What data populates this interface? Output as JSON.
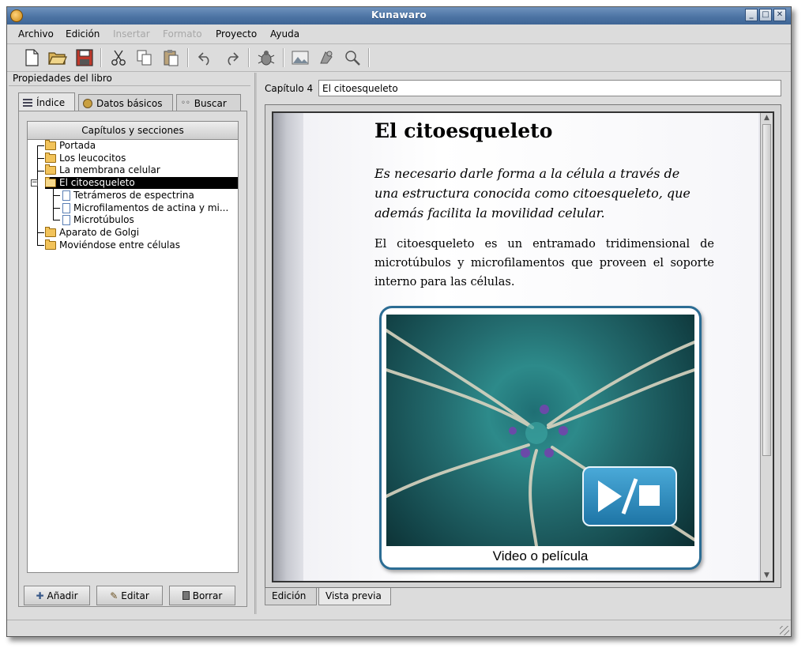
{
  "window": {
    "title": "Kunawaro"
  },
  "menu": [
    {
      "label": "Archivo",
      "enabled": true
    },
    {
      "label": "Edición",
      "enabled": true
    },
    {
      "label": "Insertar",
      "enabled": false
    },
    {
      "label": "Formato",
      "enabled": false
    },
    {
      "label": "Proyecto",
      "enabled": true
    },
    {
      "label": "Ayuda",
      "enabled": true
    }
  ],
  "toolbar": [
    "new-file-icon",
    "open-folder-icon",
    "save-icon",
    "cut-icon",
    "copy-icon",
    "paste-icon",
    "undo-icon",
    "redo-icon",
    "insert-bug-icon",
    "insert-image-icon",
    "insert-object-icon",
    "search-media-icon"
  ],
  "left_panel": {
    "header": "Propiedades del libro",
    "tabs": [
      {
        "label": "Índice",
        "icon": "list-icon",
        "active": true
      },
      {
        "label": "Datos básicos",
        "icon": "info-icon",
        "active": false
      },
      {
        "label": "Buscar",
        "icon": "glasses-icon",
        "active": false
      }
    ],
    "tree_header": "Capítulos y secciones",
    "tree": [
      {
        "label": "Portada",
        "type": "folder",
        "level": 0
      },
      {
        "label": "Los leucocitos",
        "type": "folder",
        "level": 0
      },
      {
        "label": "La membrana celular",
        "type": "folder",
        "level": 0
      },
      {
        "label": "El citoesqueleto",
        "type": "folder-open",
        "level": 0,
        "selected": true
      },
      {
        "label": "Tetrámeros de espectrina",
        "type": "page",
        "level": 1
      },
      {
        "label": "Microfilamentos de actina y mi...",
        "type": "page",
        "level": 1
      },
      {
        "label": "Microtúbulos",
        "type": "page",
        "level": 1
      },
      {
        "label": "Aparato de Golgi",
        "type": "folder",
        "level": 0
      },
      {
        "label": "Moviéndose entre células",
        "type": "folder",
        "level": 0
      }
    ],
    "buttons": {
      "add": "Añadir",
      "edit": "Editar",
      "delete": "Borrar"
    }
  },
  "chapter": {
    "label": "Capítulo 4",
    "value": "El citoesqueleto"
  },
  "preview": {
    "title": "El citoesqueleto",
    "intro": "Es necesario darle forma a la célula a través de una estructura conocida como citoesqueleto, que además facilita la movilidad celular.",
    "body": "El citoesqueleto es un entramado tridimensional de microtúbulos y microfilamentos que proveen el soporte interno para las células.",
    "media_caption": "Video o película"
  },
  "bottom_tabs": [
    {
      "label": "Edición",
      "active": false
    },
    {
      "label": "Vista previa",
      "active": true
    }
  ],
  "colors": {
    "titlebar": "#4d74a4",
    "selection": "#000000",
    "media_border": "#2c6d94",
    "play_button": "#2a8cc4"
  }
}
